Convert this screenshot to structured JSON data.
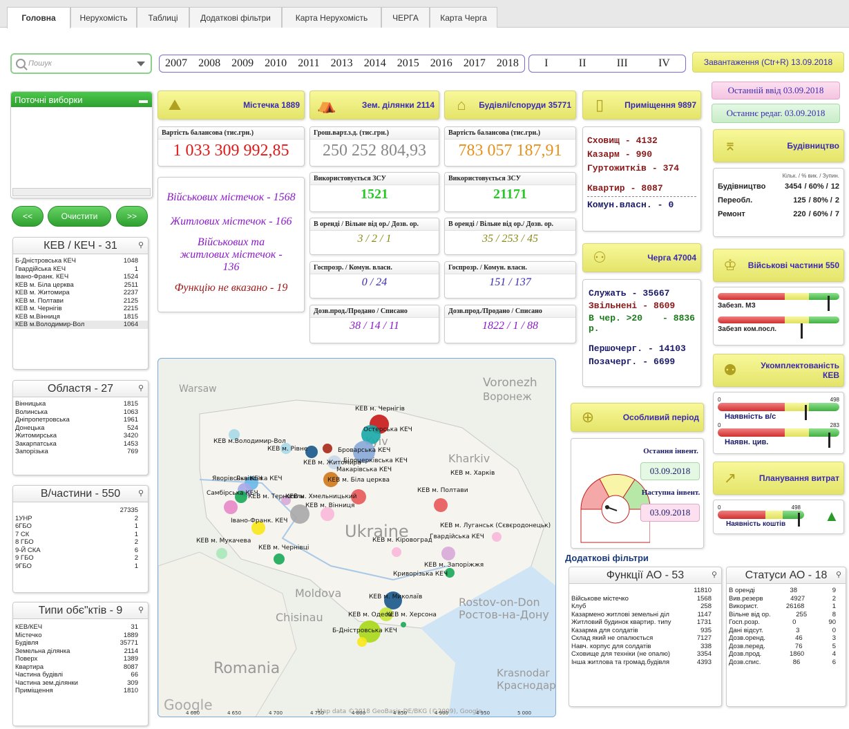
{
  "tabs": [
    "Головна",
    "Нерухомість",
    "Таблиці",
    "Додаткові фільтри",
    "Карта Нерухомість",
    "ЧЕРГА",
    "Карта Черга"
  ],
  "search": {
    "placeholder": "Пошук"
  },
  "years": [
    "2007",
    "2008",
    "2009",
    "2010",
    "2011",
    "2013",
    "2014",
    "2015",
    "2016",
    "2017",
    "2018"
  ],
  "quarters": [
    "I",
    "II",
    "III",
    "IV"
  ],
  "load": {
    "label": "Завантаження (Ctr+R)  13.09.2018"
  },
  "last_input": "Останній ввід  03.09.2018",
  "last_edit": "Останнє редаг.  03.09.2018",
  "current": {
    "title": "Поточні виборки",
    "prev": "<<",
    "clear": "Очистити",
    "next": ">>"
  },
  "kev": {
    "title": "КЕВ / КЕЧ - 31",
    "rows": [
      [
        "Б-Дністровська КЕЧ",
        "1048"
      ],
      [
        "Гвардійська КЕЧ",
        "1"
      ],
      [
        "Івано-Франк. КЕЧ",
        "1524"
      ],
      [
        "КЕВ м. Біла церква",
        "2511"
      ],
      [
        "КЕВ м. Житомира",
        "2237"
      ],
      [
        "КЕВ м. Полтави",
        "2125"
      ],
      [
        "КЕВ м. Чернігів",
        "2215"
      ],
      [
        "КЕВ м.Вінниця",
        "1815"
      ],
      [
        "КЕВ м.Володимир-Вол",
        "1064"
      ]
    ]
  },
  "oblast": {
    "title": "Областя - 27",
    "rows": [
      [
        "Вінницька",
        "1815"
      ],
      [
        "Волинська",
        "1063"
      ],
      [
        "Дніпропетровська",
        "1961"
      ],
      [
        "Донецька",
        "524"
      ],
      [
        "Житомирська",
        "3420"
      ],
      [
        "Закарпатська",
        "1453"
      ],
      [
        "Запорізька",
        "769"
      ]
    ]
  },
  "units": {
    "title": "В/частини - 550",
    "rows": [
      [
        "",
        "27335"
      ],
      [
        "1УНР",
        "2"
      ],
      [
        "6ГБО",
        "1"
      ],
      [
        "7 СК",
        "1"
      ],
      [
        "8 ГБО",
        "2"
      ],
      [
        "9-Й СКА",
        "6"
      ],
      [
        "9 ГБО",
        "2"
      ],
      [
        "9ГБО",
        "1"
      ]
    ]
  },
  "types": {
    "title": "Типи обє\"ктів - 9",
    "rows": [
      [
        "КЕВ/КЕЧ",
        "31"
      ],
      [
        "Містечко",
        "1889"
      ],
      [
        "Будівля",
        "35771"
      ],
      [
        "Земельна ділянка",
        "2114"
      ],
      [
        "Поверх",
        "1389"
      ],
      [
        "Квартира",
        "8087"
      ],
      [
        "Частина будівлі",
        "66"
      ],
      [
        "Частина зем.ділянки",
        "309"
      ],
      [
        "Приміщення",
        "1810"
      ]
    ]
  },
  "towns": {
    "title": "Містечка 1889",
    "bal_label": "Вартість балансова (тис.грн.)",
    "bal": "1 033 309 992,85",
    "lines": [
      "Військових містечок - 1568",
      "Житлових містечок - 166",
      "Військових та житлових містечок - 136",
      "Функцію не вказано - 19"
    ]
  },
  "land": {
    "title": "Зем. ділянки 2114",
    "money_label": "Грош.варт.з.д. (тис.грн.)",
    "money": "250 252 804,93",
    "zsu_label": "Використовується ЗСУ",
    "zsu": "1521",
    "rent_label": "В оренді / Вільне від ор./ Дозв. ор.",
    "rent": "3 / 2 / 1",
    "econ_label": "Госпрозр. / Комун. власн.",
    "econ": "0 / 24",
    "sale_label": "Дозв.прод./Продано / Списано",
    "sale": "38 / 14 / 11"
  },
  "build": {
    "title": "Будівлі/споруди 35771",
    "bal_label": "Вартість балансова (тис.грн.)",
    "bal": "783 057 187,91",
    "zsu_label": "Використовується ЗСУ",
    "zsu": "21171",
    "rent_label": "В оренді / Вільне від ор./ Дозв. ор.",
    "rent": "35 / 253 / 45",
    "econ_label": "Госпрозр. / Комун. власн.",
    "econ": "151 / 137",
    "sale_label": "Дозв.прод./Продано / Списано",
    "sale": "1822 / 1 / 88"
  },
  "rooms": {
    "title": "Приміщення 9897",
    "lines": [
      [
        "Сховищ",
        "-",
        "4132"
      ],
      [
        "Казарм",
        "-",
        "990"
      ],
      [
        "Гуртожитків",
        "-",
        "374"
      ],
      [
        "Квартир",
        "-",
        "8087"
      ],
      [
        "Комун.власн.",
        "-",
        "0"
      ]
    ]
  },
  "construction": {
    "title": "Будівництво",
    "header": "Кільк. / % вик. / Зупин.",
    "rows": [
      [
        "Будівництво",
        "3454",
        "/ 60% /",
        "12"
      ],
      [
        "Переобл.",
        "125",
        "/ 80% /",
        "2"
      ],
      [
        "Ремонт",
        "220",
        "/ 60% /",
        "7"
      ]
    ]
  },
  "queue": {
    "title": "Черга 47004",
    "lines": [
      [
        "Служать",
        "-",
        "35667"
      ],
      [
        "Звільнені",
        "-",
        "8609"
      ],
      [
        "В чер. >20 р.",
        "-",
        "8836"
      ],
      [
        "Першочерг.",
        "-",
        "14103"
      ],
      [
        "Позачерг.",
        "-",
        "6699"
      ]
    ]
  },
  "military": {
    "title": "Військові частини 550",
    "bar1": "Забезп. МЗ",
    "bar2": "Забезп ком.посл."
  },
  "staffing": {
    "title": "Укомплектованість КЕВ",
    "bar1": "Наявність в/с",
    "bar2": "Наявн. цив.",
    "v1": "498",
    "v2": "283",
    "z": "0"
  },
  "special": {
    "title": "Особливий період",
    "last_label": "Остання інвент.",
    "last_date": "03.09.2018",
    "next_label": "Наступна інвент.",
    "next_date": "03.09.2018"
  },
  "costs": {
    "title": "Планування витрат",
    "bar": "Наявність коштів",
    "v": "498",
    "z": "0"
  },
  "addf": {
    "title": "Додаткові фільтри",
    "func": {
      "title": "Функції АО - 53",
      "rows": [
        [
          "",
          "11810"
        ],
        [
          "Військове містечко",
          "1568"
        ],
        [
          "Клуб",
          "258"
        ],
        [
          "Казармено житлові земельні діл",
          "1147"
        ],
        [
          "Житловий будинок квартир. типу",
          "1731"
        ],
        [
          "Казарма для солдатів",
          "935"
        ],
        [
          "Склад який не опалюється",
          "7127"
        ],
        [
          "Навч. корпус для солдатів",
          "338"
        ],
        [
          "Сховище для техніки (не опалю)",
          "3354"
        ],
        [
          "Інша житлова та громад.будівля",
          "4393"
        ]
      ]
    },
    "status": {
      "title": "Статуси АО - 18",
      "rows": [
        [
          "В оренді",
          "38",
          "9"
        ],
        [
          "Вив.резерв",
          "4927",
          "2"
        ],
        [
          "Використ.",
          "26168",
          "1"
        ],
        [
          "Вільне від ор.",
          "255",
          "8"
        ],
        [
          "Госп.розр.",
          "0",
          "90"
        ],
        [
          "Дані відсут.",
          "3",
          "0"
        ],
        [
          "Дозв.оренд.",
          "46",
          "3"
        ],
        [
          "Дозв.перед.",
          "76",
          "5"
        ],
        [
          "Дозв.прод.",
          "1860",
          "4"
        ],
        [
          "Дозв.спис.",
          "86",
          "6"
        ]
      ]
    }
  },
  "map": {
    "bg_labels": [
      "Warsaw",
      "Voronezh",
      "Воронеж",
      "Kyiv",
      "Kharkiv",
      "Ukraine",
      "Moldova",
      "Chisinau",
      "Rostov-on-Don",
      "Ростов-на-Дону",
      "Romania",
      "Krasnodar",
      "Краснодар",
      "Google",
      "Map data ©2018 GeoBasis-DE/BKG (©2009), Google"
    ],
    "labels": [
      "КЕВ м. Чернігів",
      "Остерська КЕЧ",
      "КЕВ м.Володимир-Вол",
      "КЕВ м. Рівне",
      "Броварська КЕЧ",
      "Білоцерківська КЕЧ",
      "Київська КЕЧ",
      "КЕВ м. Житомира",
      "Макарівська КЕЧ",
      "КЕВ м. Харків",
      "Яворівська КЕЧ",
      "Львівська КЕЧ",
      "КЕВ м. Біла церква",
      "Самбірська КЕЧ",
      "КЕВ м. Тернопіль",
      "КЕВ м. Хмельницький",
      "КЕВ м. Полтави",
      "КЕВ м. Вінниця",
      "Івано-Франк. КЕЧ",
      "КЕВ м. Луганськ (Сєвєродонецьк)",
      "КЕВ м. Мукачева",
      "КЕВ м. Кіровоград",
      "Гвардійська КЕЧ",
      "КЕВ м. Чернівці",
      "Криворізька КЕЧ",
      "КЕВ м. Запоріжжя",
      "КЕВ м. Миколаїв",
      "КЕВ м. Одеса",
      "КЕВ м. Херсона",
      "Б-Дністровська КЕЧ"
    ],
    "ticks": [
      "4 600",
      "4 650",
      "4 700",
      "4 750",
      "4 800",
      "4 850",
      "4 900",
      "4 950",
      "5 000"
    ]
  }
}
